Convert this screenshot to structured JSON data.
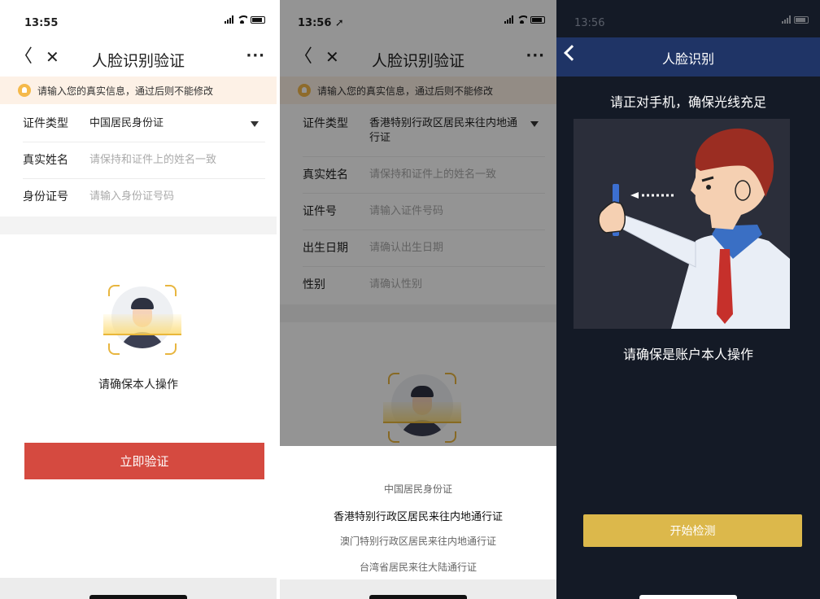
{
  "screen1": {
    "time": "13:55",
    "nav_back": "〈",
    "nav_close": "✕",
    "title": "人脸识别验证",
    "more": "···",
    "notice": "请输入您的真实信息，通过后则不能修改",
    "fields": [
      {
        "label": "证件类型",
        "value": "中国居民身份证",
        "placeholder": ""
      },
      {
        "label": "真实姓名",
        "value": "",
        "placeholder": "请保持和证件上的姓名一致"
      },
      {
        "label": "身份证号",
        "value": "",
        "placeholder": "请输入身份证号码"
      }
    ],
    "confirm_text": "请确保本人操作",
    "verify_button": "立即验证"
  },
  "screen2": {
    "time": "13:56 ➚",
    "nav_back": "〈",
    "nav_close": "✕",
    "title": "人脸识别验证",
    "more": "···",
    "notice": "请输入您的真实信息，通过后则不能修改",
    "fields": [
      {
        "label": "证件类型",
        "value": "香港特别行政区居民来往内地通行证",
        "placeholder": ""
      },
      {
        "label": "真实姓名",
        "value": "",
        "placeholder": "请保持和证件上的姓名一致"
      },
      {
        "label": "证件号",
        "value": "",
        "placeholder": "请输入证件号码"
      },
      {
        "label": "出生日期",
        "value": "",
        "placeholder": "请确认出生日期"
      },
      {
        "label": "性别",
        "value": "",
        "placeholder": "请确认性别"
      }
    ],
    "picker_options": [
      "中国居民身份证",
      "香港特别行政区居民来往内地通行证",
      "澳门特别行政区居民来往内地通行证",
      "台湾省居民来往大陆通行证"
    ],
    "picker_selected_index": 1
  },
  "screen3": {
    "time": "13:56",
    "title": "人脸识别",
    "instruction": "请正对手机，确保光线充足",
    "confirm_text": "请确保是账户本人操作",
    "start_button": "开始检测"
  },
  "colors": {
    "primary_red": "#d54a40",
    "accent_yellow": "#dcb84b",
    "dark_nav": "#1f3466",
    "dark_bg": "#141a26",
    "notice_bg": "#fdf1e6"
  },
  "icons": [
    "back-icon",
    "close-icon",
    "more-icon",
    "lightbulb-icon",
    "dropdown-caret-icon",
    "signal-icon",
    "wifi-icon",
    "battery-icon",
    "face-scan-icon"
  ]
}
